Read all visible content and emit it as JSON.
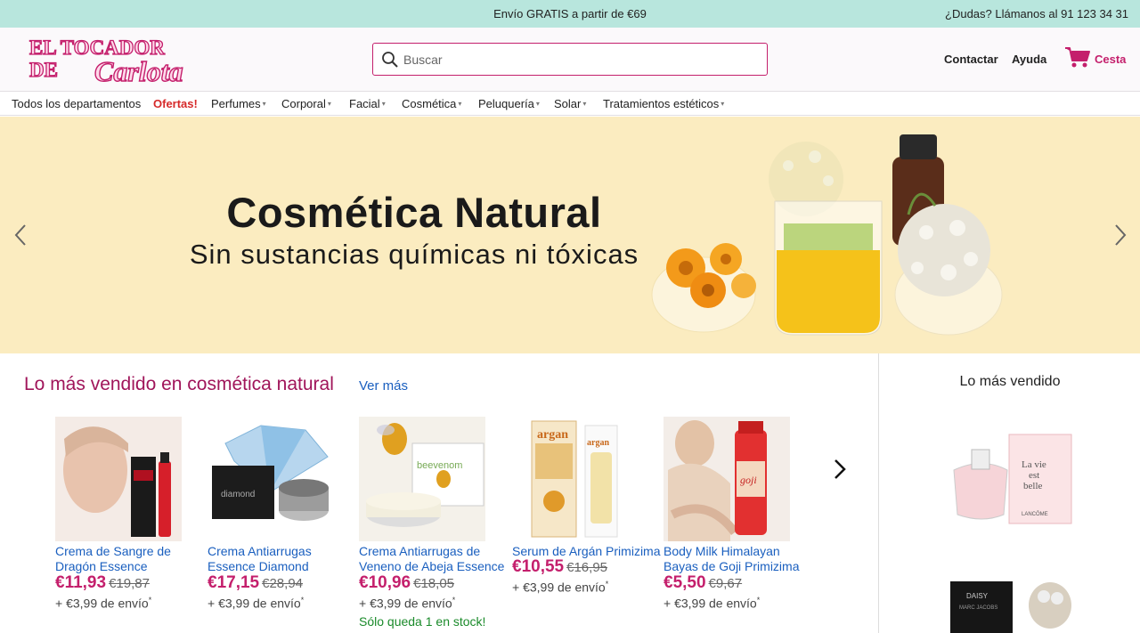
{
  "topbar": {
    "promo": "Envío GRATIS a partir de €69",
    "phone": "¿Dudas? Llámanos al 91 123 34 31"
  },
  "header": {
    "logo_text_1": "EL TOCADOR",
    "logo_text_2": "DE",
    "logo_text_3": "Carlota",
    "search_placeholder": "Buscar",
    "contact": "Contactar",
    "help": "Ayuda",
    "cart": "Cesta"
  },
  "nav": {
    "items": [
      {
        "label": "Todos los departamentos"
      },
      {
        "label": "Ofertas!"
      },
      {
        "label": "Perfumes"
      },
      {
        "label": "Corporal"
      },
      {
        "label": "Facial"
      },
      {
        "label": "Cosmética"
      },
      {
        "label": "Peluquería"
      },
      {
        "label": "Solar"
      },
      {
        "label": "Tratamientos estéticos"
      }
    ]
  },
  "hero": {
    "title": "Cosmética Natural",
    "subtitle": "Sin sustancias químicas ni tóxicas"
  },
  "section": {
    "title": "Lo más vendido en cosmética natural",
    "more": "Ver más",
    "products": [
      {
        "name_1": "Crema de Sangre de",
        "name_2": "Dragón Essence",
        "price": "€11,93",
        "old": "€19,87",
        "ship": "+ €3,99 de envío",
        "stock": ""
      },
      {
        "name_1": "Crema Antiarrugas",
        "name_2": "Essence Diamond",
        "price": "€17,15",
        "old": "€28,94",
        "ship": "+ €3,99 de envío",
        "stock": ""
      },
      {
        "name_1": "Crema Antiarrugas de",
        "name_2": "Veneno de Abeja Essence",
        "price": "€10,96",
        "old": "€18,05",
        "ship": "+ €3,99 de envío",
        "stock": "Sólo queda 1 en stock!"
      },
      {
        "name_1": "Serum de Argán Primizima",
        "name_2": "",
        "price": "€10,55",
        "old": "€16,95",
        "ship": "+ €3,99 de envío",
        "stock": ""
      },
      {
        "name_1": "Body Milk Himalayan",
        "name_2": "Bayas de Goji Primizima",
        "price": "€5,50",
        "old": "€9,67",
        "ship": "+ €3,99 de envío",
        "stock": ""
      }
    ]
  },
  "side": {
    "title": "Lo más vendido",
    "product_1_label_1": "La vie",
    "product_1_label_2": "est",
    "product_1_label_3": "belle",
    "product_1_brand": "LANCÔME",
    "product_2_label": "DAISY",
    "product_2_brand": "MARC JACOBS"
  },
  "colors": {
    "accent": "#c41f6c",
    "link": "#1a5fbf",
    "topbar": "#b8e6dd",
    "hero_bg": "#fbecc0"
  }
}
